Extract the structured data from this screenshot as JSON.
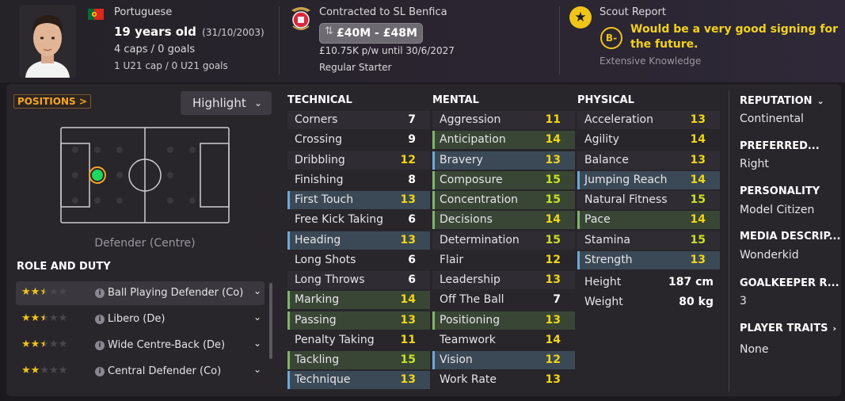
{
  "player": {
    "nationality": "Portuguese",
    "age": "19 years old",
    "dob": "(31/10/2003)",
    "caps": "4 caps / 0 goals",
    "u21": "1 U21 cap / 0 U21 goals"
  },
  "contract": {
    "status": "Contracted to SL Benfica",
    "value": "£40M - £48M",
    "wage": "£10.75K p/w until 30/6/2027",
    "squad_role": "Regular Starter"
  },
  "scout": {
    "title": "Scout Report",
    "grade": "B-",
    "text": "Would be a very good signing for the future.",
    "knowledge": "Extensive Knowledge"
  },
  "positions": {
    "button": "POSITIONS >",
    "highlight": "Highlight",
    "label": "Defender (Centre)"
  },
  "role_duty": {
    "title": "ROLE AND DUTY",
    "rows": [
      {
        "name": "Ball Playing Defender (Co)",
        "stars": 2.5
      },
      {
        "name": "Libero (De)",
        "stars": 2.5
      },
      {
        "name": "Wide Centre-Back (De)",
        "stars": 2.5
      },
      {
        "name": "Central Defender (Co)",
        "stars": 2
      }
    ]
  },
  "technical": {
    "title": "TECHNICAL",
    "rows": [
      {
        "name": "Corners",
        "value": "7"
      },
      {
        "name": "Crossing",
        "value": "9"
      },
      {
        "name": "Dribbling",
        "value": "12"
      },
      {
        "name": "Finishing",
        "value": "8"
      },
      {
        "name": "First Touch",
        "value": "13"
      },
      {
        "name": "Free Kick Taking",
        "value": "6"
      },
      {
        "name": "Heading",
        "value": "13"
      },
      {
        "name": "Long Shots",
        "value": "6"
      },
      {
        "name": "Long Throws",
        "value": "6"
      },
      {
        "name": "Marking",
        "value": "14"
      },
      {
        "name": "Passing",
        "value": "13"
      },
      {
        "name": "Penalty Taking",
        "value": "11"
      },
      {
        "name": "Tackling",
        "value": "15"
      },
      {
        "name": "Technique",
        "value": "13"
      }
    ]
  },
  "mental": {
    "title": "MENTAL",
    "rows": [
      {
        "name": "Aggression",
        "value": "11"
      },
      {
        "name": "Anticipation",
        "value": "14"
      },
      {
        "name": "Bravery",
        "value": "13"
      },
      {
        "name": "Composure",
        "value": "15"
      },
      {
        "name": "Concentration",
        "value": "15"
      },
      {
        "name": "Decisions",
        "value": "14"
      },
      {
        "name": "Determination",
        "value": "15"
      },
      {
        "name": "Flair",
        "value": "12"
      },
      {
        "name": "Leadership",
        "value": "13"
      },
      {
        "name": "Off The Ball",
        "value": "7"
      },
      {
        "name": "Positioning",
        "value": "13"
      },
      {
        "name": "Teamwork",
        "value": "14"
      },
      {
        "name": "Vision",
        "value": "12"
      },
      {
        "name": "Work Rate",
        "value": "13"
      }
    ]
  },
  "physical": {
    "title": "PHYSICAL",
    "rows": [
      {
        "name": "Acceleration",
        "value": "13"
      },
      {
        "name": "Agility",
        "value": "14"
      },
      {
        "name": "Balance",
        "value": "13"
      },
      {
        "name": "Jumping Reach",
        "value": "14"
      },
      {
        "name": "Natural Fitness",
        "value": "15"
      },
      {
        "name": "Pace",
        "value": "14"
      },
      {
        "name": "Stamina",
        "value": "15"
      },
      {
        "name": "Strength",
        "value": "13"
      }
    ],
    "height_label": "Height",
    "height": "187 cm",
    "weight_label": "Weight",
    "weight": "80 kg"
  },
  "info": {
    "reputation_h": "REPUTATION",
    "reputation": "Continental",
    "preferred_h": "PREFERRED...",
    "preferred": "Right",
    "personality_h": "PERSONALITY",
    "personality": "Model Citizen",
    "media_h": "MEDIA DESCRIP...",
    "media": "Wonderkid",
    "gk_h": "GOALKEEPER R...",
    "gk": "3",
    "traits_h": "PLAYER TRAITS",
    "traits": "None"
  },
  "colors": {
    "accent_orange": "#f5a623",
    "scout_yellow": "#f2d21c",
    "key_blue": "#6ea9d8",
    "pref_green": "#7fb56b",
    "position_dot": "#1ed760"
  }
}
